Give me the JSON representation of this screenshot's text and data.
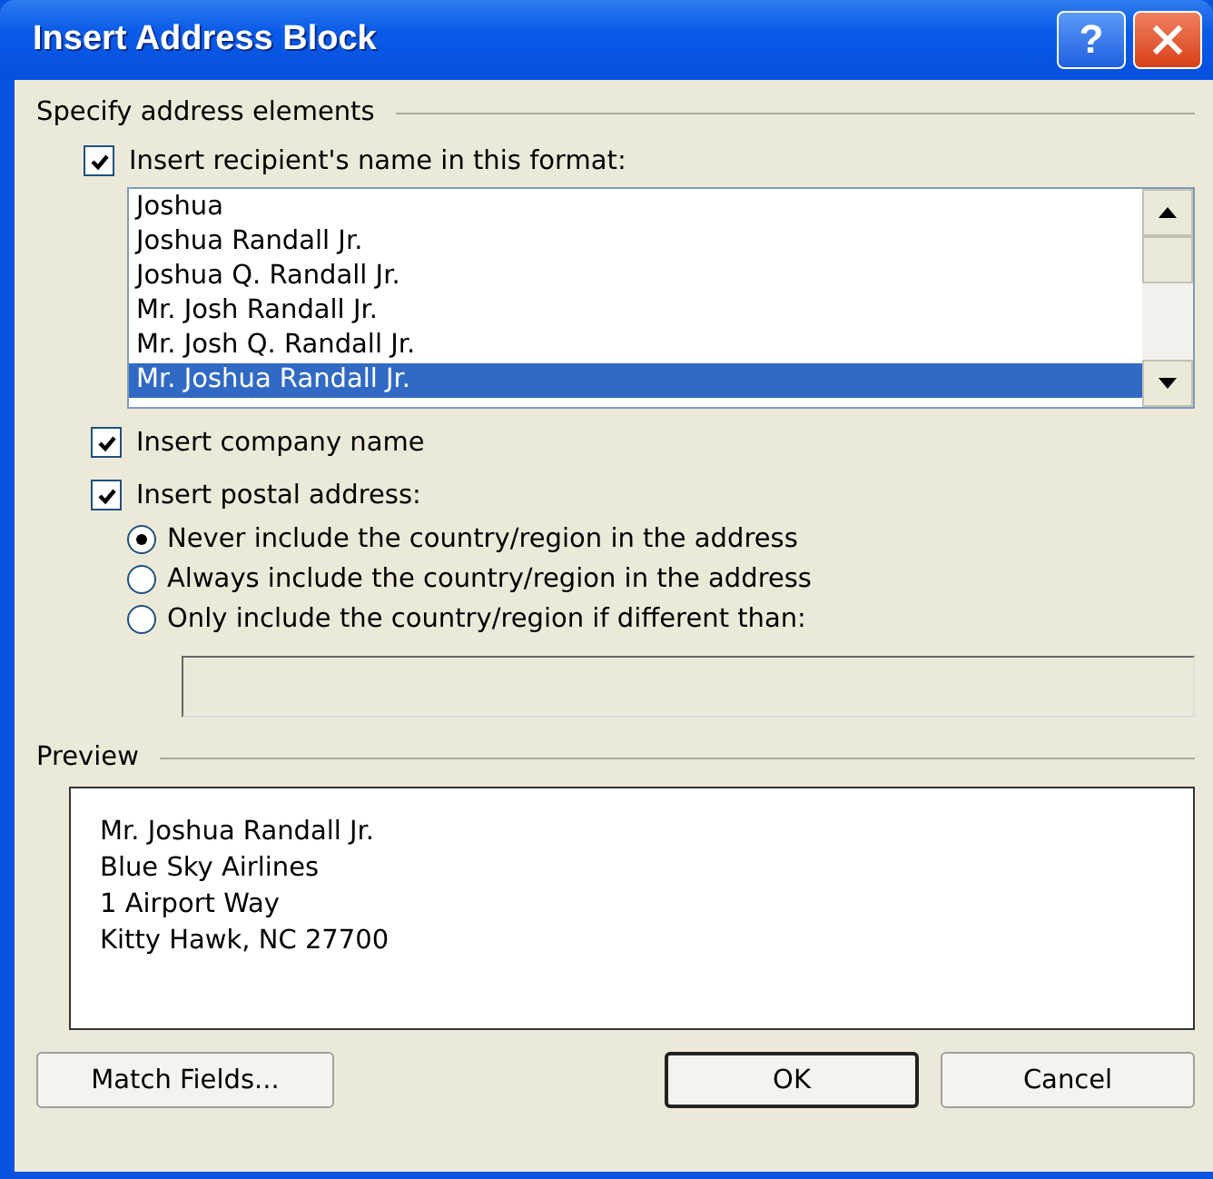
{
  "window": {
    "title": "Insert Address Block",
    "controls": [
      {
        "kind": "help",
        "label": "?"
      },
      {
        "kind": "close"
      }
    ]
  },
  "address_elements": {
    "heading": "Specify address elements",
    "name_format": {
      "label": "Insert recipient's name in this format:",
      "checked": true,
      "options": [
        {
          "label": "Joshua",
          "selected": false
        },
        {
          "label": "Joshua Randall Jr.",
          "selected": false
        },
        {
          "label": "Joshua Q. Randall Jr.",
          "selected": false
        },
        {
          "label": "Mr. Josh Randall Jr.",
          "selected": false
        },
        {
          "label": "Mr. Josh Q. Randall Jr.",
          "selected": false
        },
        {
          "label": "Mr. Joshua Randall Jr.",
          "selected": true
        }
      ]
    },
    "company": {
      "label": "Insert company name",
      "checked": true
    },
    "postal": {
      "label": "Insert postal address:",
      "checked": true,
      "country_options": [
        {
          "label": "Never include the country/region in the address",
          "selected": true
        },
        {
          "label": "Always include the country/region in the address",
          "selected": false
        },
        {
          "label": "Only include the country/region if different than:",
          "selected": false
        }
      ],
      "country_field": {
        "disabled": true
      }
    }
  },
  "preview": {
    "heading": "Preview",
    "lines": [
      "Mr. Joshua Randall Jr.",
      "Blue Sky Airlines",
      "1 Airport Way",
      "Kitty Hawk, NC 27700"
    ]
  },
  "buttons": [
    {
      "label": "Match Fields...",
      "kind": "default"
    },
    {
      "label": "OK",
      "kind": "primary"
    },
    {
      "label": "Cancel",
      "kind": "default"
    }
  ]
}
